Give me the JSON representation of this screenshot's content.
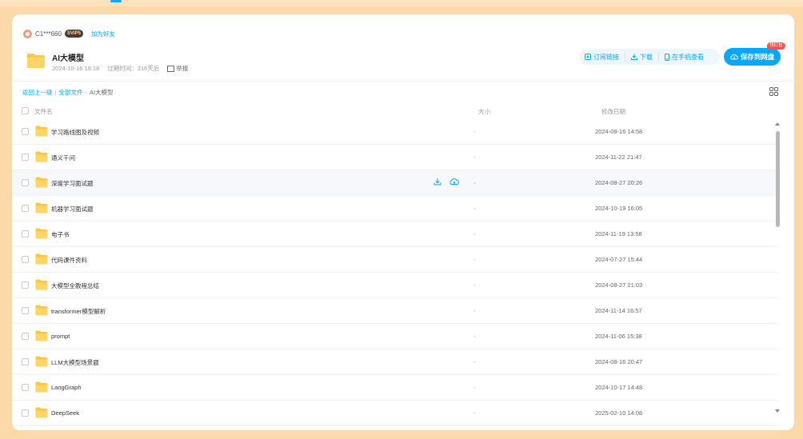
{
  "sharer": {
    "name": "C1***660",
    "badge": "SVIP5",
    "add_friend": "加为好友"
  },
  "share": {
    "title": "AI大模型",
    "date": "2024-10-16 19:18",
    "expire": "过期时间：216天后",
    "report": "举报"
  },
  "actions": {
    "subscribe": "订阅链接",
    "download": "下载",
    "phone": "在手机查看",
    "save": "保存到网盘",
    "save_badge": "领红包"
  },
  "breadcrumb": {
    "back": "返回上一级",
    "all_files": "全部文件",
    "current": "AI大模型"
  },
  "table": {
    "col_name": "文件名",
    "col_size": "大小",
    "col_date": "修改日期",
    "rows": [
      {
        "name": "学习路线图及视频",
        "size": "-",
        "date": "2024-08-16 14:58"
      },
      {
        "name": "通义千问",
        "size": "-",
        "date": "2024-11-22 21:47"
      },
      {
        "name": "深度学习面试题",
        "size": "-",
        "date": "2024-08-27 20:26"
      },
      {
        "name": "机器学习面试题",
        "size": "-",
        "date": "2024-10-19 16:05"
      },
      {
        "name": "电子书",
        "size": "-",
        "date": "2024-11-19 13:58"
      },
      {
        "name": "代码课件资料",
        "size": "-",
        "date": "2024-07-27 15:44"
      },
      {
        "name": "大模型全教程总结",
        "size": "-",
        "date": "2024-08-27 21:03"
      },
      {
        "name": "transformer模型解析",
        "size": "-",
        "date": "2024-11-14 16:57"
      },
      {
        "name": "prompt",
        "size": "-",
        "date": "2024-11-06 15:38"
      },
      {
        "name": "LLM大模型场景题",
        "size": "-",
        "date": "2024-08-16 20:47"
      },
      {
        "name": "LangGraph",
        "size": "-",
        "date": "2024-10-17 14:48"
      },
      {
        "name": "DeepSeek",
        "size": "-",
        "date": "2025-02-10 14:08"
      }
    ]
  },
  "colors": {
    "accent": "#06a7ff",
    "page_bg": "#fbd9a8",
    "folder": "#ffc83d"
  }
}
